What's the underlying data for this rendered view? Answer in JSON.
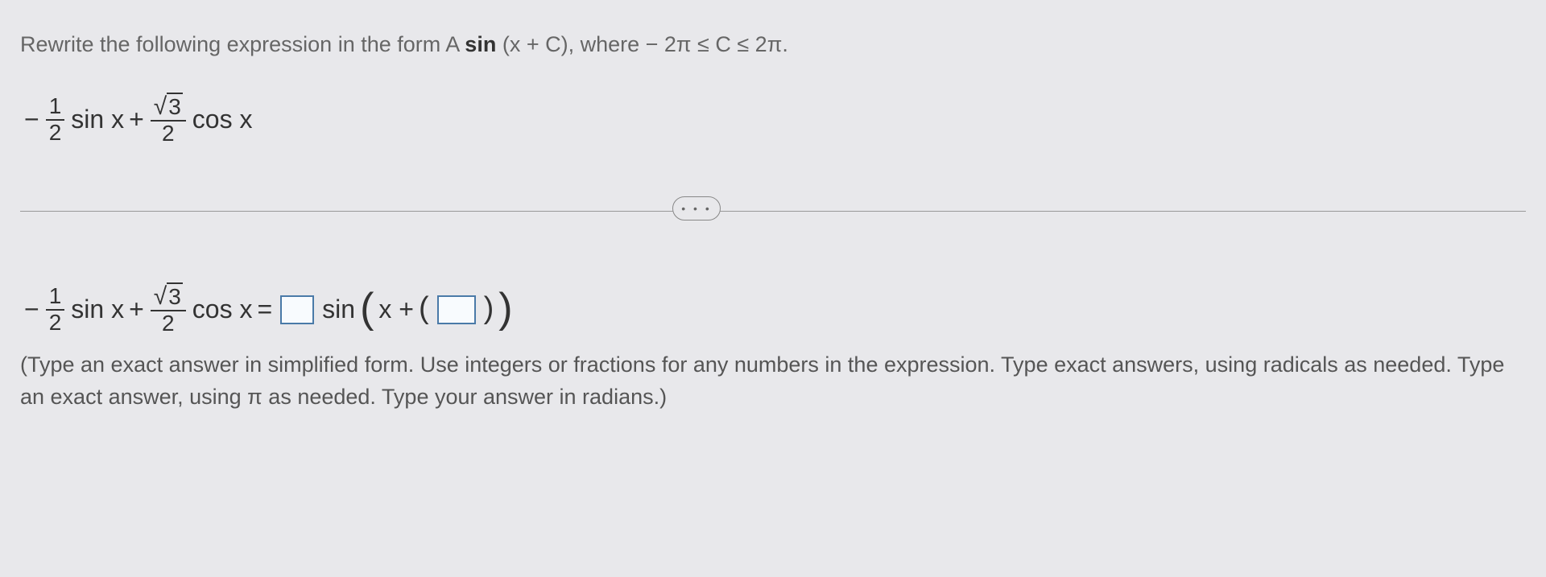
{
  "prompt": {
    "prefix": "Rewrite the following expression in the form A",
    "bold1": "sin",
    "mid": " (x + C), where ",
    "range": " − 2π ≤ C ≤ 2π."
  },
  "expr": {
    "minus": "−",
    "half_num": "1",
    "half_den": "2",
    "sin": "sin x",
    "plus": "+",
    "sqrt3": "3",
    "den2": "2",
    "cos": "cos x"
  },
  "ellipsis": "• • •",
  "answer": {
    "equals": "=",
    "sin": "sin",
    "xplus": "x +",
    "lparen_big": "(",
    "rparen_big": ")",
    "lparen_med": "(",
    "rparen_med": ")"
  },
  "hint": "(Type an exact answer in simplified form. Use integers or fractions for any numbers in the expression. Type exact answers, using radicals as needed. Type an exact answer, using π as needed. Type your answer in radians.)"
}
